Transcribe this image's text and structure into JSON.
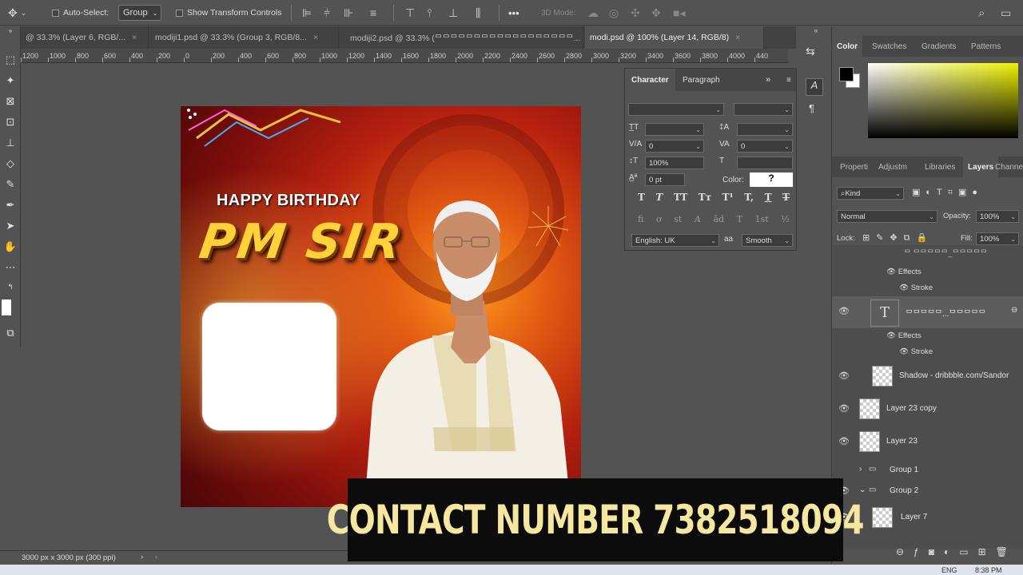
{
  "options_bar": {
    "auto_select_label": "Auto-Select:",
    "auto_select_value": "Group",
    "show_transform_label": "Show Transform Controls",
    "more_label": "•••",
    "mode_3d_label": "3D Mode:"
  },
  "tabs": [
    {
      "label": "@ 33.3% (Layer 6, RGB/...",
      "close": "×"
    },
    {
      "label": "modiji1.psd @ 33.3% (Group 3, RGB/8...",
      "close": "×"
    },
    {
      "label": "modiji2.psd @ 33.3% (ᄆᄆᄆᄆᄆᄆᄆᄆᄆᄆᄆᄆᄆᄆᄆᄆᄆᄆ...",
      "close": "×"
    },
    {
      "label": "modi.psd @ 100% (Layer 14, RGB/8)",
      "close": "×"
    }
  ],
  "ruler_labels": [
    "1200",
    "1000",
    "800",
    "600",
    "400",
    "200",
    "0",
    "200",
    "400",
    "600",
    "800",
    "1000",
    "1200",
    "1400",
    "1600",
    "1800",
    "2000",
    "2200",
    "2400",
    "2600",
    "2800",
    "3000",
    "3200",
    "3400",
    "3600",
    "3800",
    "4000",
    "440"
  ],
  "poster": {
    "happy_birthday": "HAPPY BIRTHDAY",
    "headline": "PM SIR"
  },
  "character_panel": {
    "tab_character": "Character",
    "tab_paragraph": "Paragraph",
    "kerning_value": "0",
    "tracking_value": "0",
    "vertical_scale": "100%",
    "baseline_shift": "0 pt",
    "color_label": "Color:",
    "color_value": "?",
    "language": "English: UK",
    "antialias_label": "aa",
    "antialias": "Smooth",
    "style_buttons": [
      "T",
      "T",
      "TT",
      "Tт",
      "T¹",
      "T,",
      "T",
      "T"
    ],
    "feature_buttons": [
      "fi",
      "ơ",
      "st",
      "A",
      "ād",
      "T",
      "1st",
      "½"
    ]
  },
  "color_panel": {
    "tabs": [
      "Color",
      "Swatches",
      "Gradients",
      "Patterns"
    ],
    "foreground": "#000000",
    "background": "#ffffff"
  },
  "layers_panel": {
    "tabs": [
      "Properti",
      "Adjustm",
      "Libraries",
      "Layers",
      "Channe"
    ],
    "filter_kind": "Kind",
    "blend_mode": "Normal",
    "opacity_label": "Opacity:",
    "opacity_value": "100%",
    "lock_label": "Lock:",
    "fill_label": "Fill:",
    "fill_value": "100%",
    "top_partial": "ᄆ ᄆᄆᄆᄆᄆ_ᄆᄆᄆᄆᄆ",
    "effects_label": "Effects",
    "stroke_label": "Stroke",
    "text_layer_name": "ᄆᄆᄆᄆᄆ...ᄆᄆᄆᄆᄆ",
    "layers": [
      {
        "name": "Shadow - dribbble.com/Sandor"
      },
      {
        "name": "Layer 23 copy"
      },
      {
        "name": "Layer 23"
      },
      {
        "name": "Group 1"
      },
      {
        "name": "Group 2"
      },
      {
        "name": "Layer 7"
      }
    ]
  },
  "status_bar": {
    "doc_size": "3000 px x 3000 px (300 ppi)"
  },
  "taskbar": {
    "lang": "ENG",
    "time": "8:38 PM"
  },
  "overlay": {
    "contact": "CONTACT NUMBER 7382518094"
  }
}
